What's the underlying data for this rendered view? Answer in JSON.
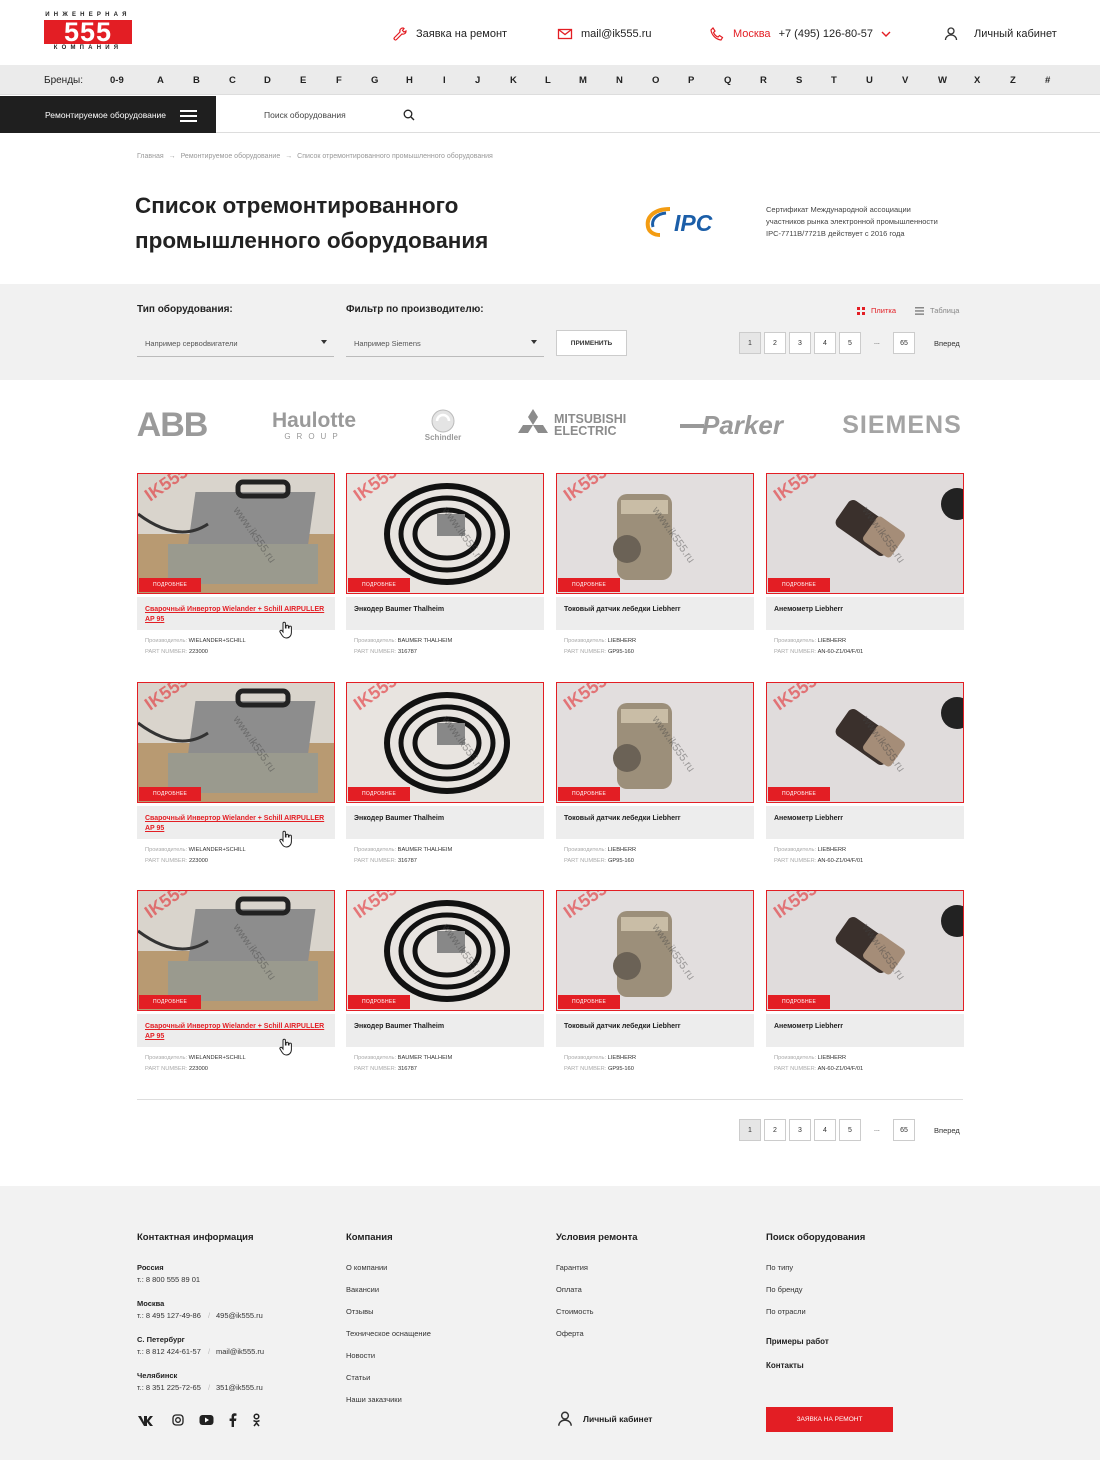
{
  "brand": {
    "name_top": "ИНЖЕНЕРНАЯ",
    "digits": "555",
    "name_bottom": "КОМПАНИЯ"
  },
  "header": {
    "repair_link": "Заявка на ремонт",
    "email": "mail@ik555.ru",
    "city": "Москва",
    "phone": "+7 (495) 126-80-57",
    "cabinet": "Личный кабинет"
  },
  "brands_bar": {
    "label": "Бренды:",
    "letters": [
      "0-9",
      "A",
      "B",
      "C",
      "D",
      "E",
      "F",
      "G",
      "H",
      "I",
      "J",
      "K",
      "L",
      "M",
      "N",
      "O",
      "P",
      "Q",
      "R",
      "S",
      "T",
      "U",
      "V",
      "W",
      "X",
      "Z",
      "#"
    ]
  },
  "nav": {
    "catalog_button": "Ремонтируемое оборудование",
    "search_placeholder": "Поиск оборудования"
  },
  "breadcrumb": {
    "items": [
      "Главная",
      "Ремонтируемое оборудование",
      "Список отремонтированного промышленного оборудования"
    ],
    "separator": "→"
  },
  "page": {
    "title_line1": "Список отремонтированного",
    "title_line2": "промышленного оборудования",
    "ipc_logo": "IPC",
    "cert_line1": "Сертификат Международной ассоциации",
    "cert_line2": "участников рынка электронной промышленности",
    "cert_line3": "IPC-7711B/7721B действует с 2016 года"
  },
  "filters": {
    "type_label": "Тип оборудования:",
    "type_placeholder": "Например сервodвигатели",
    "maker_label": "Фильтр по производителю:",
    "maker_placeholder": "Например Siemens",
    "apply": "ПРИМЕНИТЬ",
    "view_tile": "Плитка",
    "view_table": "Таблица"
  },
  "pagination": {
    "pages": [
      "1",
      "2",
      "3",
      "4",
      "5"
    ],
    "dots": "...",
    "last": "65",
    "next": "Вперед",
    "current": "1"
  },
  "brand_logos": {
    "abb": "ABB",
    "haulotte": "Haulotte",
    "haulotte_sub": "GROUP",
    "schindler": "Schindler",
    "mitsubishi1": "MITSUBISHI",
    "mitsubishi2": "ELECTRIC",
    "parker": "Parker",
    "siemens": "SIEMENS"
  },
  "card_labels": {
    "more": "ПОДРОБНЕЕ",
    "maker": "Производитель:",
    "part": "PART NUMBER:"
  },
  "products": [
    {
      "title": "Сварочный Инвертор Wielander + Schill AIRPULLER AP 95",
      "maker": "WIELANDER+SCHILL",
      "part": "223000"
    },
    {
      "title": "Энкодер Baumer Thalheim",
      "maker": "BAUMER THALHEIM",
      "part": "316787"
    },
    {
      "title": "Токовый датчик лебедки Liebherr",
      "maker": "LIEBHERR",
      "part": "GP95-160"
    },
    {
      "title": "Анемометр Liebherr",
      "maker": "LIEBHERR",
      "part": "AN-60-Z1/04/F/01"
    }
  ],
  "watermark": "www.ik555.ru",
  "footer": {
    "contacts_title": "Контактная информация",
    "company_title": "Компания",
    "repair_title": "Условия ремонта",
    "search_title": "Поиск оборудования",
    "russia": "Россия",
    "russia_phone": "т.: 8 800 555 89 01",
    "moscow": "Москва",
    "moscow_phone": "т.: 8 495 127-49-86",
    "moscow_mail": "495@ik555.ru",
    "spb": "С. Петербург",
    "spb_phone": "т.: 8 812 424-61-57",
    "spb_mail": "mail@ik555.ru",
    "chel": "Челябинск",
    "chel_phone": "т.: 8 351 225-72-65",
    "chel_mail": "351@ik555.ru",
    "company_links": [
      "О компании",
      "Вакансии",
      "Отзывы",
      "Техническое оснащение",
      "Новости",
      "Статьи",
      "Наши заказчики"
    ],
    "repair_links": [
      "Гарантия",
      "Оплата",
      "Стоимость",
      "Оферта"
    ],
    "search_links": [
      "По типу",
      "По бренду",
      "По отрасли"
    ],
    "examples": "Примеры работ",
    "contacts": "Контакты",
    "cabinet": "Личный кабинет",
    "cta": "ЗАЯВКА НА РЕМОНТ",
    "social": {
      "vk": "vk-icon",
      "instagram": "instagram-icon",
      "youtube": "youtube-icon",
      "facebook": "facebook-icon",
      "ok": "ok-icon"
    }
  },
  "colors": {
    "accent": "#e31e24",
    "dark": "#1f1f1f",
    "bar": "#ebebeb",
    "filter_bg": "#f1f1f1",
    "footer_bg": "#f2f2f2"
  }
}
